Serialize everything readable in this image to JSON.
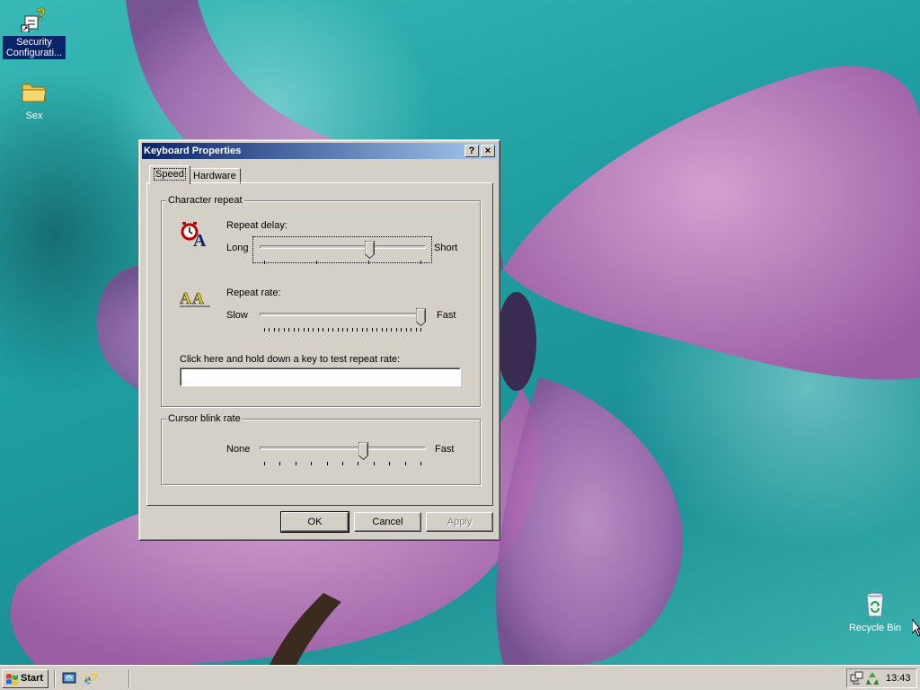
{
  "desktop": {
    "icons": [
      {
        "label": "Security Configurati...",
        "icon": "security-config-icon"
      },
      {
        "label": "Sex",
        "icon": "folder-icon"
      },
      {
        "label": "Recycle Bin",
        "icon": "recycle-bin-icon"
      }
    ]
  },
  "dialog": {
    "title": "Keyboard Properties",
    "help_button": "?",
    "close_button": "×",
    "tabs": [
      {
        "label": "Speed",
        "active": true
      },
      {
        "label": "Hardware",
        "active": false
      }
    ],
    "character_repeat": {
      "group_label": "Character repeat",
      "repeat_delay": {
        "label": "Repeat delay:",
        "min_label": "Long",
        "max_label": "Short",
        "value_fraction": 0.67,
        "tick_count": 4,
        "icon": "repeat-delay-icon"
      },
      "repeat_rate": {
        "label": "Repeat rate:",
        "min_label": "Slow",
        "max_label": "Fast",
        "value_fraction": 1.0,
        "tick_count": 33,
        "icon": "repeat-rate-icon"
      },
      "test_label": "Click here and hold down a key to test repeat rate:",
      "test_value": ""
    },
    "cursor_blink": {
      "group_label": "Cursor blink rate",
      "min_label": "None",
      "max_label": "Fast",
      "value_fraction": 0.63,
      "tick_count": 11
    },
    "buttons": {
      "ok": "OK",
      "cancel": "Cancel",
      "apply": "Apply"
    }
  },
  "taskbar": {
    "start_label": "Start",
    "quick_launch": [
      "show-desktop-icon",
      "internet-explorer-icon"
    ],
    "tray_icons": [
      "network-icon",
      "recycle-tray-icon"
    ],
    "clock": "13:43"
  },
  "colors": {
    "window_face": "#d4d0c8",
    "titlebar_start": "#0a246a",
    "titlebar_end": "#a6caf0",
    "desktop": "#2aa7a8",
    "flower": "#b46fb4"
  }
}
